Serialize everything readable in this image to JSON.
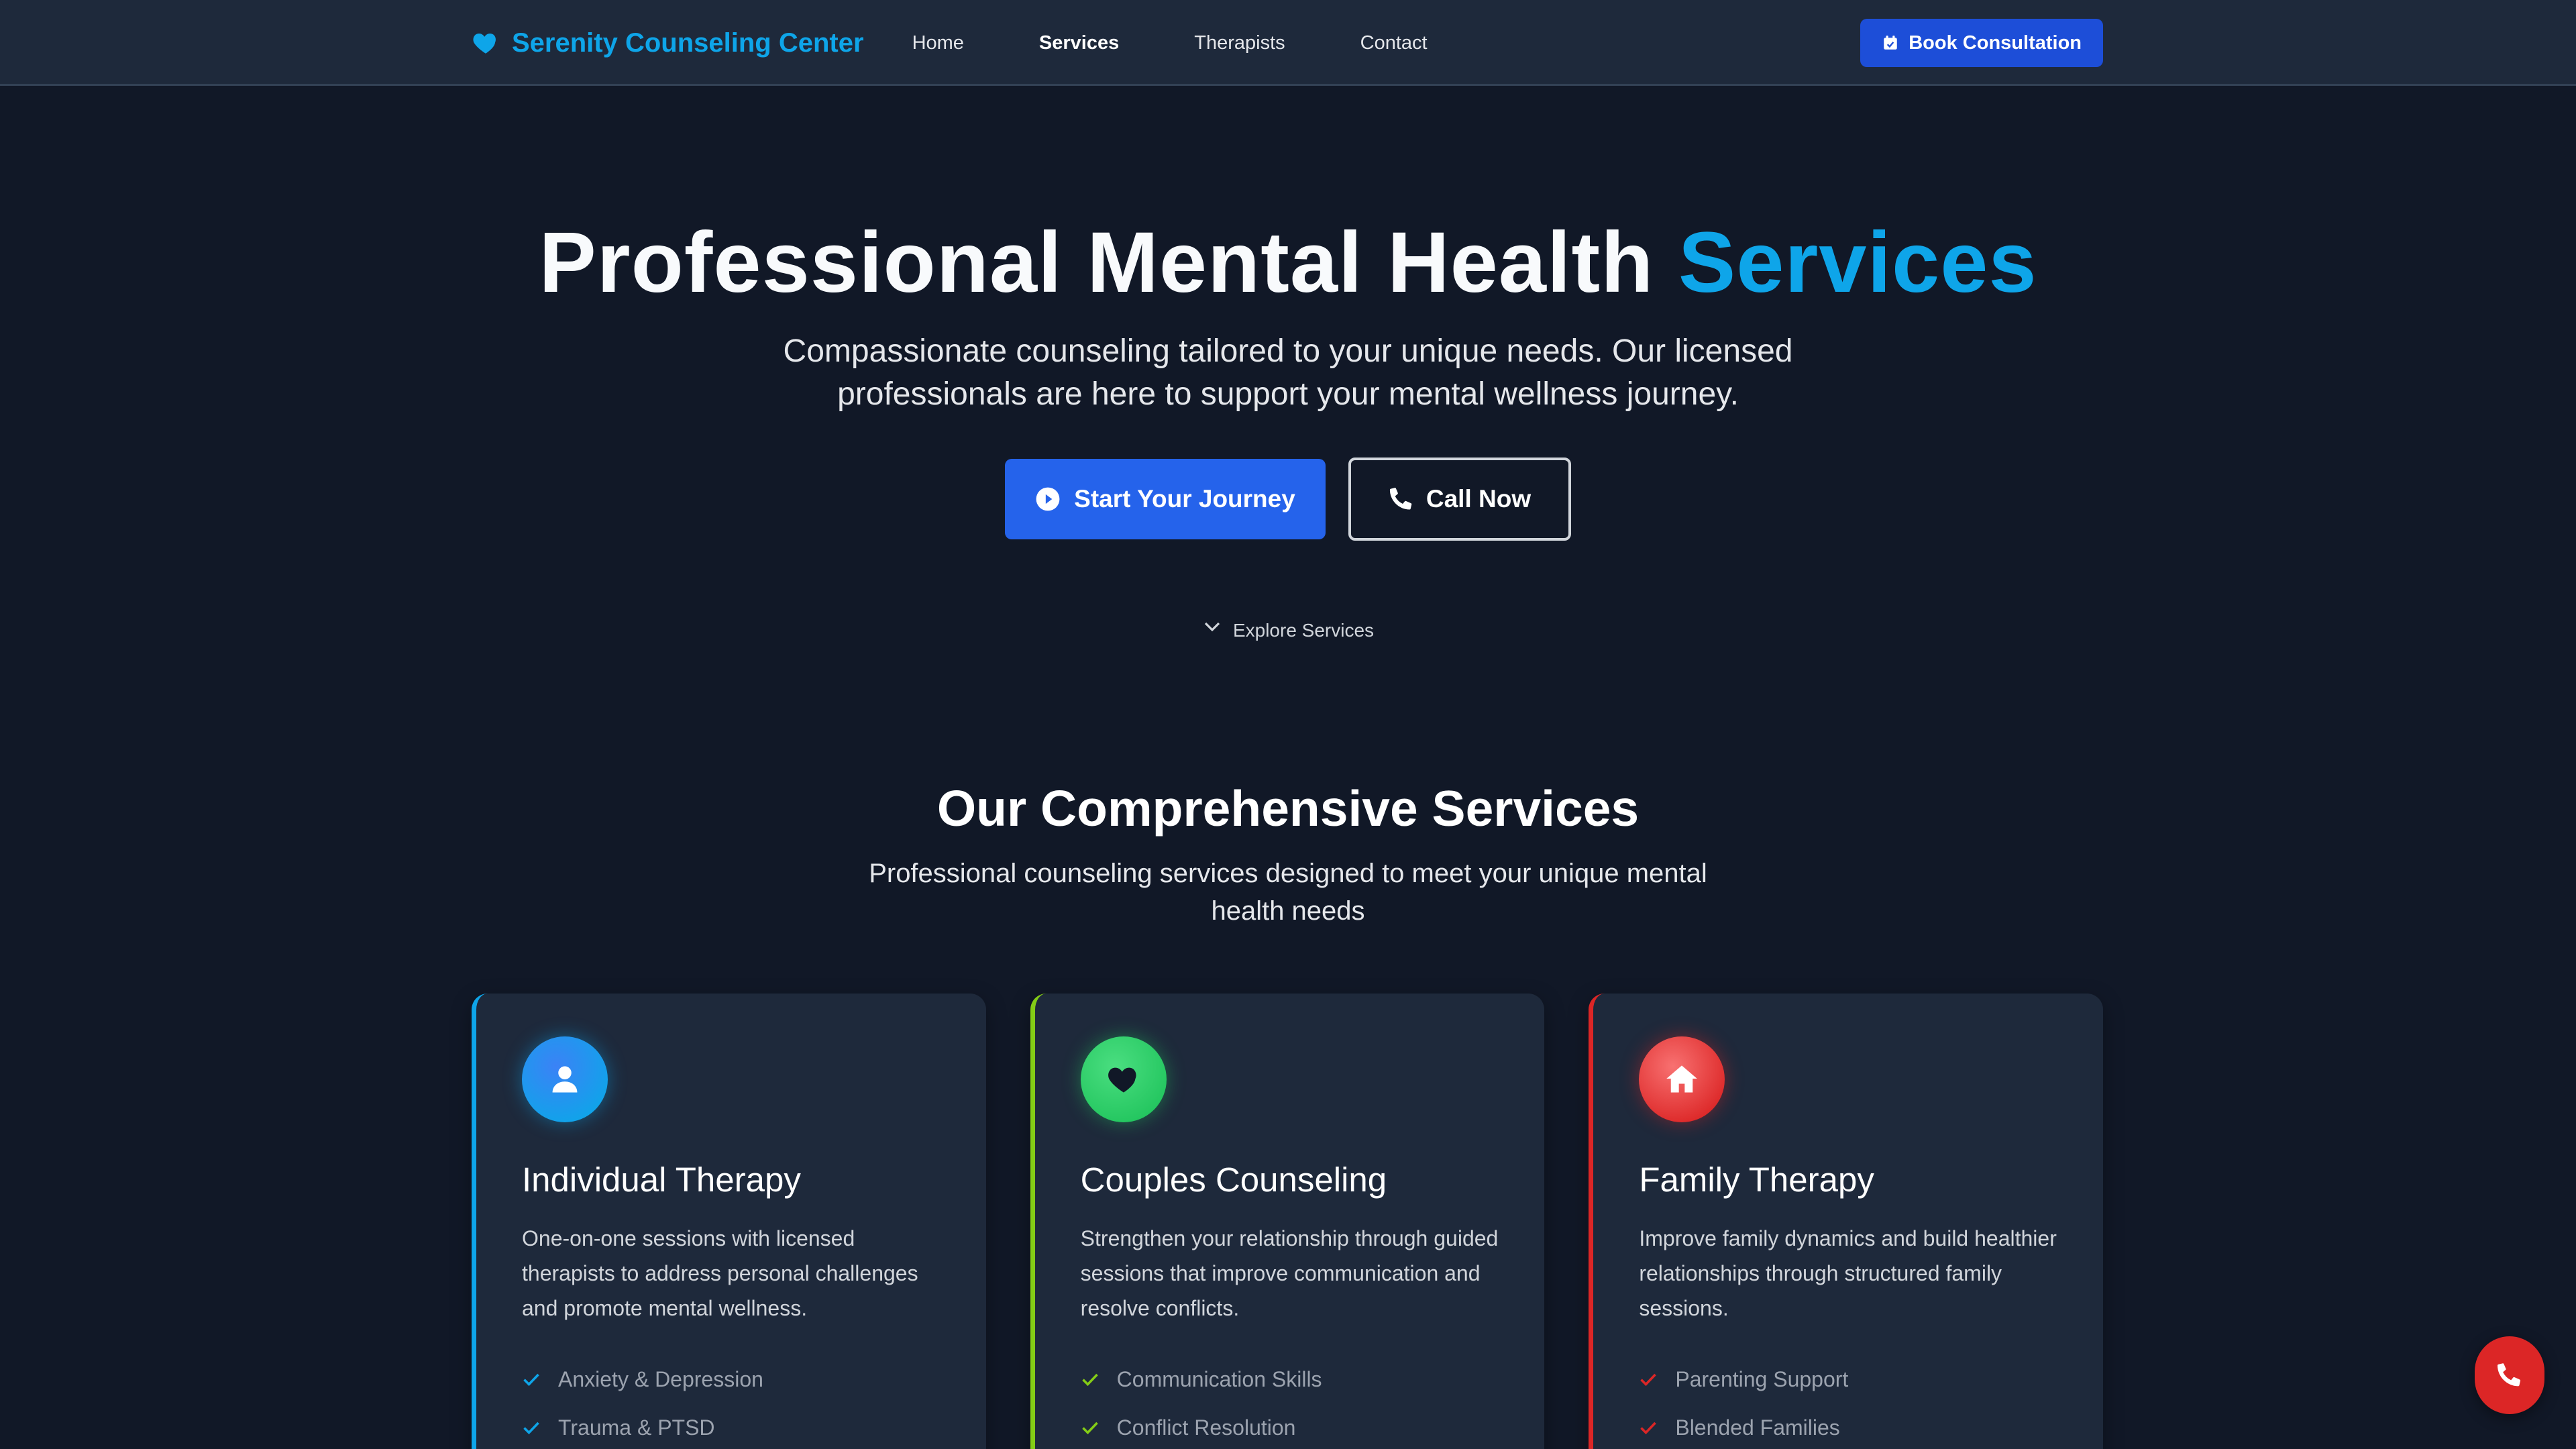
{
  "nav": {
    "brand": "Serenity Counseling Center",
    "links": [
      "Home",
      "Services",
      "Therapists",
      "Contact"
    ],
    "active_link": "Services",
    "book_label": "Book Consultation"
  },
  "hero": {
    "title_main": "Professional Mental Health ",
    "title_accent": "Services",
    "subtitle": "Compassionate counseling tailored to your unique needs. Our licensed professionals are here to support your mental wellness journey.",
    "primary_label": "Start Your Journey",
    "secondary_label": "Call Now",
    "explore_label": "Explore Services"
  },
  "services": {
    "title": "Our Comprehensive Services",
    "subtitle": "Professional counseling services designed to meet your unique mental health needs",
    "cards": [
      {
        "title": "Individual Therapy",
        "icon": "user-icon",
        "color": "#0ea5e9",
        "description": "One-on-one sessions with licensed therapists to address personal challenges and promote mental wellness.",
        "items": [
          "Anxiety & Depression",
          "Trauma & PTSD"
        ]
      },
      {
        "title": "Couples Counseling",
        "icon": "heart-icon",
        "color": "#84cc16",
        "description": "Strengthen your relationship through guided sessions that improve communication and resolve conflicts.",
        "items": [
          "Communication Skills",
          "Conflict Resolution"
        ]
      },
      {
        "title": "Family Therapy",
        "icon": "home-icon",
        "color": "#dc2626",
        "description": "Improve family dynamics and build healthier relationships through structured family sessions.",
        "items": [
          "Parenting Support",
          "Blended Families"
        ]
      }
    ]
  },
  "colors": {
    "background": "#111827",
    "nav": "#1e293b",
    "accent": "#0ea5e9",
    "primary": "#2563eb",
    "danger": "#dc2626"
  }
}
